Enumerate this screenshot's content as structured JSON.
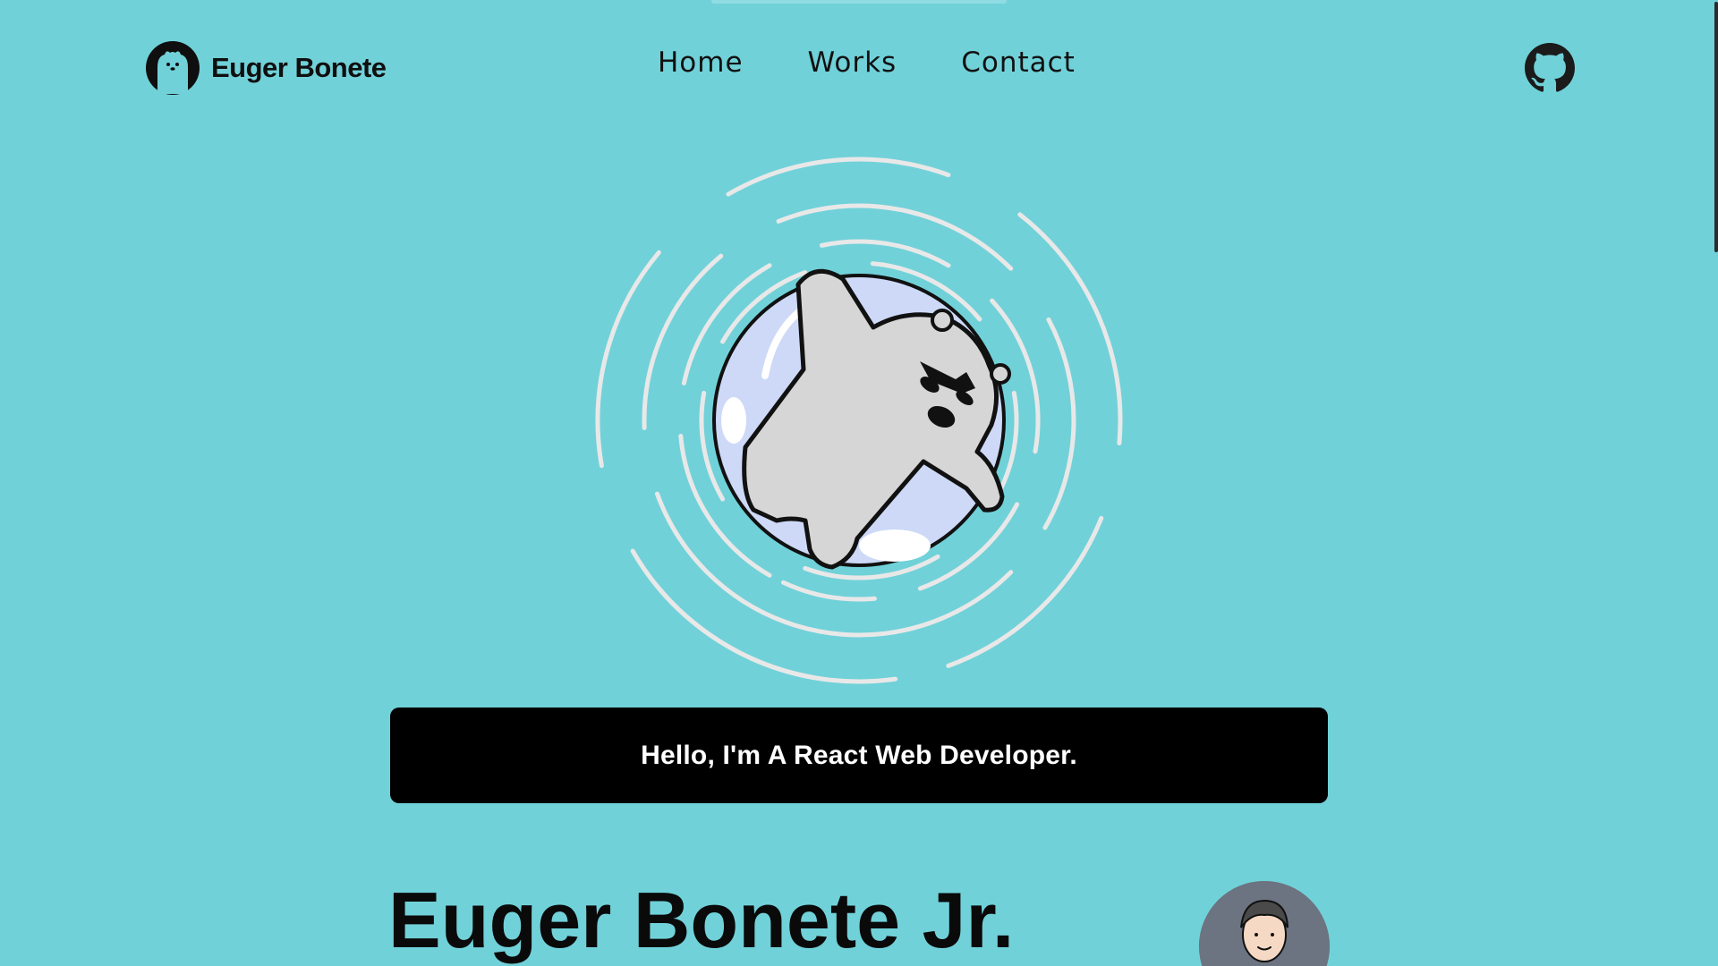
{
  "colors": {
    "background": "#71d1d9",
    "banner_bg": "#000000",
    "banner_text": "#ffffff",
    "ring": "#e8e8e8",
    "bear_body": "#d6d6d6",
    "bubble": "#cdd9f7",
    "avatar_bg": "#6b7480",
    "scrollbar": "#2b2b2b"
  },
  "header": {
    "brand_name": "Euger Bonete",
    "brand_icon": "polar-bear-logo-icon",
    "nav": [
      "Home",
      "Works",
      "Contact"
    ],
    "github_icon": "github-icon"
  },
  "hero": {
    "illustration": "polar-bear-floating-in-bubble",
    "greeting": "Hello, I'm A React Web Developer."
  },
  "profile": {
    "name": "Euger Bonete Jr.",
    "avatar_icon": "businessman-avatar-icon"
  }
}
